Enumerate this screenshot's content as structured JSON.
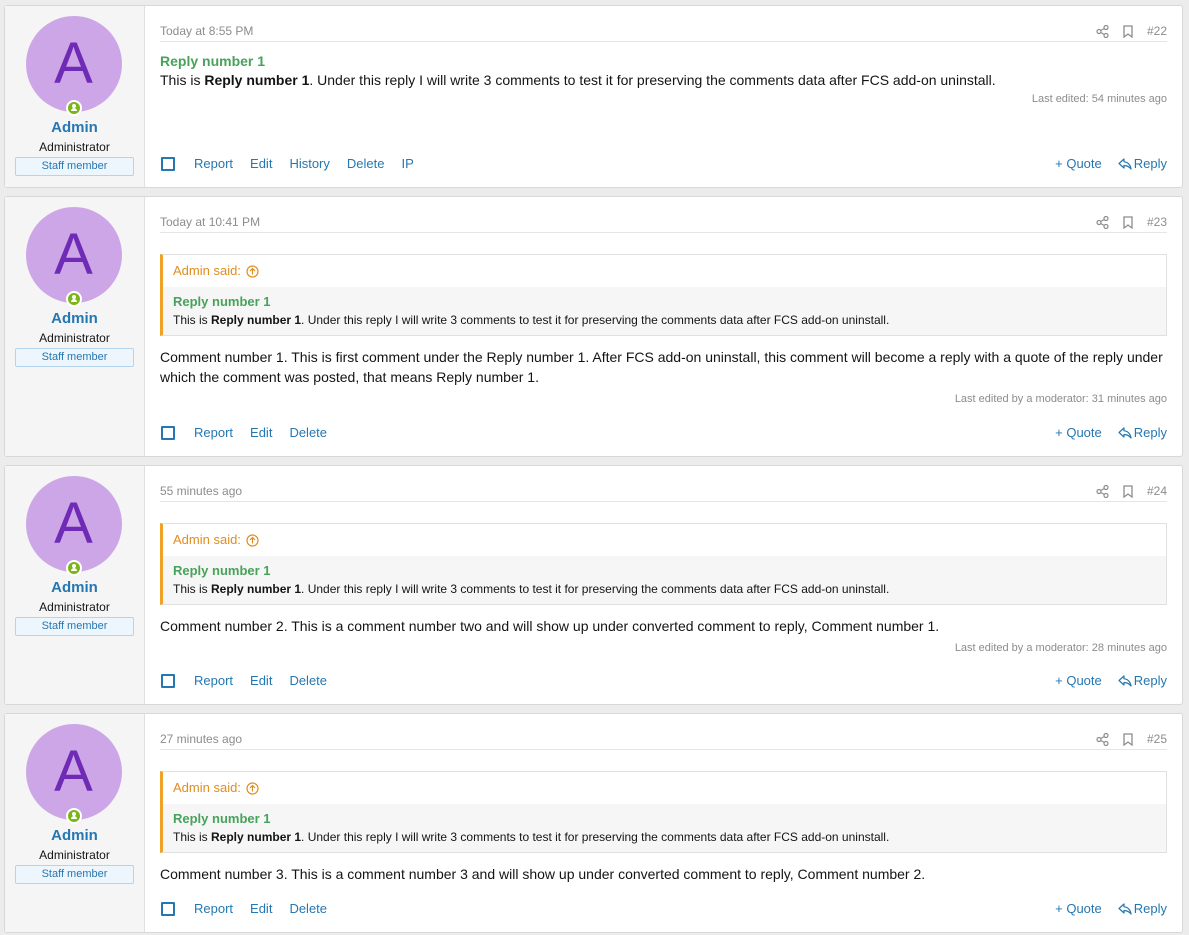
{
  "posts": [
    {
      "user": {
        "avatar_letter": "A",
        "name": "Admin",
        "title": "Administrator",
        "badge": "Staff member"
      },
      "time": "Today at 8:55 PM",
      "number": "#22",
      "heading": "Reply number 1",
      "text_before": "This is ",
      "text_bold": "Reply number 1",
      "text_after": ". Under this reply I will write 3 comments to test it for preserving the comments data after FCS add-on uninstall.",
      "edited": "Last edited: 54 minutes ago",
      "actions": [
        "Report",
        "Edit",
        "History",
        "Delete",
        "IP"
      ],
      "quote_label": "+ Quote",
      "reply_label": "Reply"
    },
    {
      "user": {
        "avatar_letter": "A",
        "name": "Admin",
        "title": "Administrator",
        "badge": "Staff member"
      },
      "time": "Today at 10:41 PM",
      "number": "#23",
      "quote": {
        "author": "Admin said:",
        "title": "Reply number 1",
        "text_before": "This is ",
        "text_bold": "Reply number 1",
        "text_after": ". Under this reply I will write 3 comments to test it for preserving the comments data after FCS add-on uninstall."
      },
      "text": "Comment number 1. This is first comment under the Reply number 1. After FCS add-on uninstall, this comment will become a reply with a quote of the reply under which the comment was posted, that means Reply number 1.",
      "edited": "Last edited by a moderator: 31 minutes ago",
      "actions": [
        "Report",
        "Edit",
        "Delete"
      ],
      "quote_label": "+ Quote",
      "reply_label": "Reply"
    },
    {
      "user": {
        "avatar_letter": "A",
        "name": "Admin",
        "title": "Administrator",
        "badge": "Staff member"
      },
      "time": "55 minutes ago",
      "number": "#24",
      "quote": {
        "author": "Admin said:",
        "title": "Reply number 1",
        "text_before": "This is ",
        "text_bold": "Reply number 1",
        "text_after": ". Under this reply I will write 3 comments to test it for preserving the comments data after FCS add-on uninstall."
      },
      "text": "Comment number 2. This is a comment number two and will show up under converted comment to reply, Comment number 1.",
      "edited": "Last edited by a moderator: 28 minutes ago",
      "actions": [
        "Report",
        "Edit",
        "Delete"
      ],
      "quote_label": "+ Quote",
      "reply_label": "Reply"
    },
    {
      "user": {
        "avatar_letter": "A",
        "name": "Admin",
        "title": "Administrator",
        "badge": "Staff member"
      },
      "time": "27 minutes ago",
      "number": "#25",
      "quote": {
        "author": "Admin said:",
        "title": "Reply number 1",
        "text_before": "This is ",
        "text_bold": "Reply number 1",
        "text_after": ". Under this reply I will write 3 comments to test it for preserving the comments data after FCS add-on uninstall."
      },
      "text": "Comment number 3. This is a comment number 3 and will show up under converted comment to reply, Comment number 2.",
      "actions": [
        "Report",
        "Edit",
        "Delete"
      ],
      "quote_label": "+ Quote",
      "reply_label": "Reply"
    }
  ],
  "icons": {
    "share": "share-icon",
    "bookmark": "bookmark-icon",
    "online": "online-status-icon",
    "arrow_up": "arrow-up-circle-icon",
    "reply": "reply-arrow-icon"
  },
  "colors": {
    "avatar_bg": "#cda6e8",
    "avatar_letter": "#6f2bb5",
    "link": "#2577b1",
    "heading_green": "#47a25a",
    "quote_accent": "#f0a228"
  }
}
